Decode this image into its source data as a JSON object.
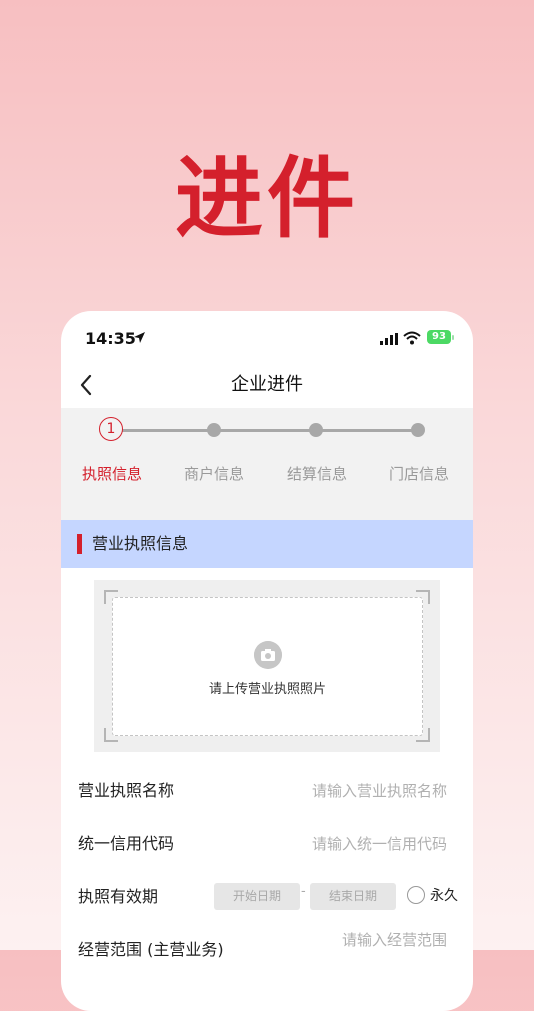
{
  "hero": {
    "title": "进件"
  },
  "status_bar": {
    "time": "14:35",
    "battery": "93"
  },
  "navbar": {
    "title": "企业进件"
  },
  "steps": {
    "current": "1",
    "labels": [
      "执照信息",
      "商户信息",
      "结算信息",
      "门店信息"
    ]
  },
  "section": {
    "title": "营业执照信息"
  },
  "upload": {
    "text": "请上传营业执照照片"
  },
  "form": {
    "license_name": {
      "label": "营业执照名称",
      "placeholder": "请输入营业执照名称"
    },
    "credit_code": {
      "label": "统一信用代码",
      "placeholder": "请输入统一信用代码"
    },
    "validity": {
      "label": "执照有效期",
      "start_placeholder": "开始日期",
      "separator": "-",
      "end_placeholder": "结束日期",
      "permanent_label": "永久"
    },
    "business_scope": {
      "label": "经营范围 (主营业务)",
      "placeholder": "请输入经营范围"
    }
  },
  "colors": {
    "accent": "#d4202c",
    "section_bg": "#c5d6ff",
    "battery": "#4cd964"
  }
}
